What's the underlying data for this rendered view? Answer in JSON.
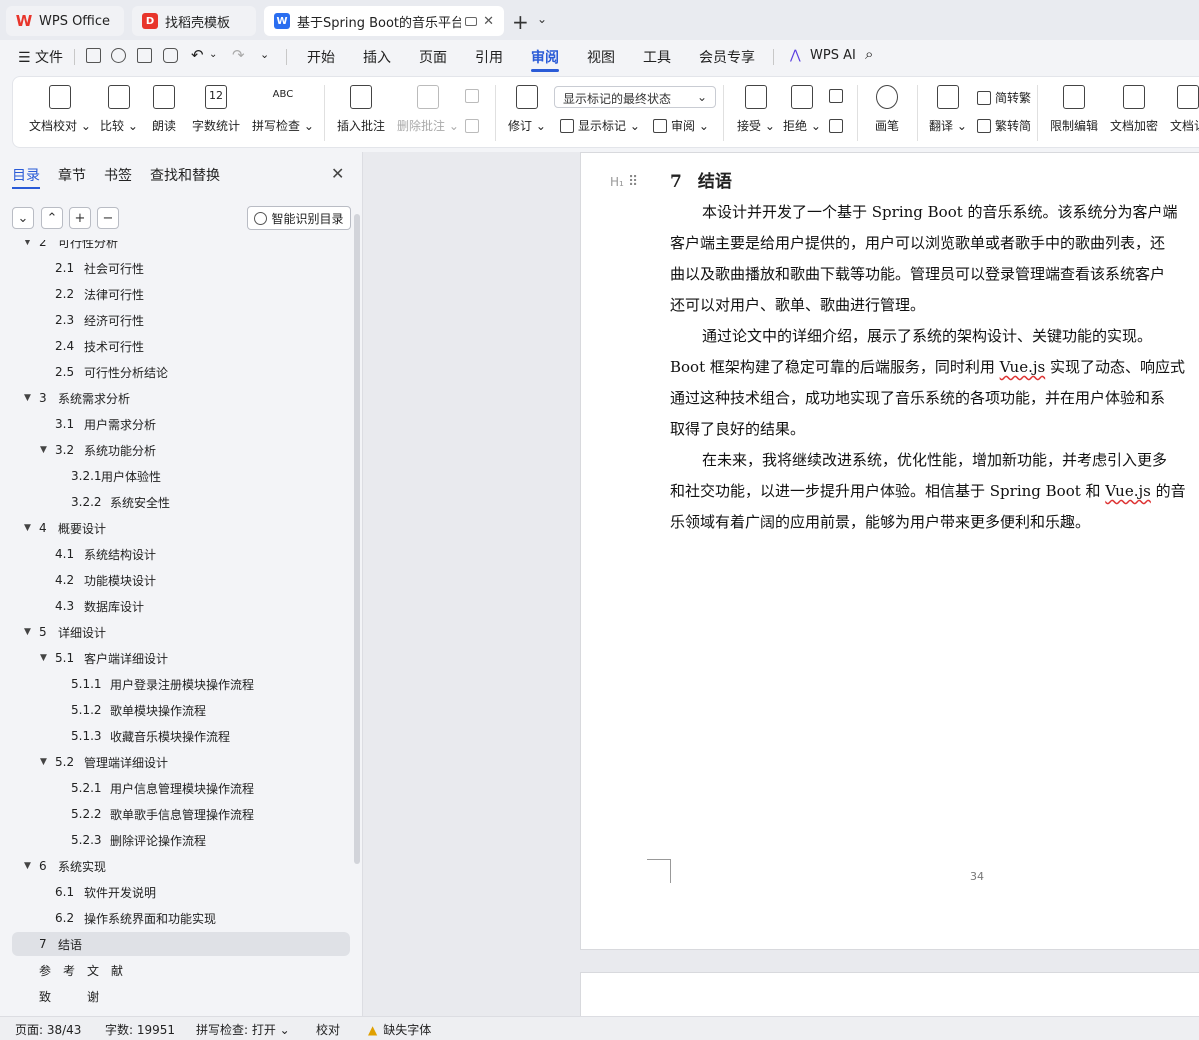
{
  "tabs": [
    {
      "label": "WPS Office",
      "icon": "wps-logo-icon"
    },
    {
      "label": "找稻壳模板",
      "icon": "docer-icon"
    },
    {
      "label": "基于Spring Boot的音乐平台设",
      "icon": "word-doc-icon"
    }
  ],
  "menu": {
    "file": "文件",
    "items": [
      "开始",
      "插入",
      "页面",
      "引用",
      "审阅",
      "视图",
      "工具",
      "会员专享"
    ],
    "active": "审阅",
    "wps_ai": "WPS AI"
  },
  "ribbon": {
    "doc_check": "文档校对",
    "compare": "比较",
    "read_aloud": "朗读",
    "word_count": "字数统计",
    "word_count_icon_text": "12",
    "spell_check": "拼写检查",
    "spell_icon_text": "ABC",
    "insert_comment": "插入批注",
    "delete_comment": "删除批注",
    "track_changes": "修订",
    "markup_mode": "显示标记的最终状态",
    "show_markup": "显示标记",
    "review": "审阅",
    "accept": "接受",
    "reject": "拒绝",
    "pen": "画笔",
    "translate": "翻译",
    "to_traditional": "简转繁",
    "to_simplified": "繁转简",
    "restrict_edit": "限制编辑",
    "encrypt": "文档加密",
    "doc_more": "文档认"
  },
  "nav": {
    "tabs": [
      "目录",
      "章节",
      "书签",
      "查找和替换"
    ],
    "smart_toc": "智能识别目录",
    "toc": [
      {
        "num": "2",
        "text": "可行性分析",
        "level": 1,
        "expanded": true
      },
      {
        "num": "2.1",
        "text": "社会可行性",
        "level": 2
      },
      {
        "num": "2.2",
        "text": "法律可行性",
        "level": 2
      },
      {
        "num": "2.3",
        "text": "经济可行性",
        "level": 2
      },
      {
        "num": "2.4",
        "text": "技术可行性",
        "level": 2
      },
      {
        "num": "2.5",
        "text": "可行性分析结论",
        "level": 2
      },
      {
        "num": "3",
        "text": "系统需求分析",
        "level": 1,
        "expanded": true
      },
      {
        "num": "3.1",
        "text": "用户需求分析",
        "level": 2
      },
      {
        "num": "3.2",
        "text": "系统功能分析",
        "level": 2,
        "expanded": true
      },
      {
        "num": "3.2.1",
        "text": "用户体验性",
        "level": 3
      },
      {
        "num": "3.2.2",
        "text": "系统安全性",
        "level": 3
      },
      {
        "num": "4",
        "text": "概要设计",
        "level": 1,
        "expanded": true
      },
      {
        "num": "4.1",
        "text": "系统结构设计",
        "level": 2
      },
      {
        "num": "4.2",
        "text": "功能模块设计",
        "level": 2
      },
      {
        "num": "4.3",
        "text": "数据库设计",
        "level": 2
      },
      {
        "num": "5",
        "text": "详细设计",
        "level": 1,
        "expanded": true
      },
      {
        "num": "5.1",
        "text": "客户端详细设计",
        "level": 2,
        "expanded": true
      },
      {
        "num": "5.1.1",
        "text": "用户登录注册模块操作流程",
        "level": 3
      },
      {
        "num": "5.1.2",
        "text": "歌单模块操作流程",
        "level": 3
      },
      {
        "num": "5.1.3",
        "text": "收藏音乐模块操作流程",
        "level": 3
      },
      {
        "num": "5.2",
        "text": "管理端详细设计",
        "level": 2,
        "expanded": true
      },
      {
        "num": "5.2.1",
        "text": "用户信息管理模块操作流程",
        "level": 3
      },
      {
        "num": "5.2.2",
        "text": "歌单歌手信息管理操作流程",
        "level": 3
      },
      {
        "num": "5.2.3",
        "text": "删除评论操作流程",
        "level": 3
      },
      {
        "num": "6",
        "text": "系统实现",
        "level": 1,
        "expanded": true
      },
      {
        "num": "6.1",
        "text": "软件开发说明",
        "level": 2
      },
      {
        "num": "6.2",
        "text": "操作系统界面和功能实现",
        "level": 2
      },
      {
        "num": "7",
        "text": "结语",
        "level": 1,
        "selected": true
      },
      {
        "num": "",
        "text": "参　考　文　献",
        "level": 1
      },
      {
        "num": "",
        "text": "致　　　谢",
        "level": 1
      }
    ]
  },
  "document": {
    "heading_num": "7",
    "heading_text": "结语",
    "lines": [
      {
        "indent": true,
        "parts": [
          {
            "t": "本设计并开发了一个基于 Spring Boot 的音乐系统。该系统分为客户端"
          }
        ]
      },
      {
        "indent": false,
        "parts": [
          {
            "t": "客户端主要是给用户提供的，用户可以浏览歌单或者歌手中的歌曲列表，还"
          }
        ]
      },
      {
        "indent": false,
        "parts": [
          {
            "t": "曲以及歌曲播放和歌曲下载等功能。管理员可以登录管理端查看该系统客户"
          }
        ]
      },
      {
        "indent": false,
        "parts": [
          {
            "t": "还可以对用户、歌单、歌曲进行管理。"
          }
        ]
      },
      {
        "indent": true,
        "parts": [
          {
            "t": "通过论文中的详细介绍，展示了系统的架构设计、关键功能的实现。"
          }
        ]
      },
      {
        "indent": false,
        "parts": [
          {
            "t": "Boot 框架构建了稳定可靠的后端服务，同时利用 "
          },
          {
            "t": "Vue.js",
            "wavy": true
          },
          {
            "t": " 实现了动态、响应式"
          }
        ]
      },
      {
        "indent": false,
        "parts": [
          {
            "t": "通过这种技术组合，成功地实现了音乐系统的各项功能，并在用户体验和系"
          }
        ]
      },
      {
        "indent": false,
        "parts": [
          {
            "t": "取得了良好的结果。"
          }
        ]
      },
      {
        "indent": true,
        "parts": [
          {
            "t": "在未来，我将继续改进系统，优化性能，增加新功能，并考虑引入更多"
          }
        ]
      },
      {
        "indent": false,
        "parts": [
          {
            "t": "和社交功能，以进一步提升用户体验。相信基于 Spring Boot 和 "
          },
          {
            "t": "Vue.js",
            "wavy": true
          },
          {
            "t": " 的音"
          }
        ]
      },
      {
        "indent": false,
        "parts": [
          {
            "t": "乐领域有着广阔的应用前景，能够为用户带来更多便利和乐趣。"
          }
        ]
      }
    ],
    "page_number": "34"
  },
  "status": {
    "page": "页面: 38/43",
    "word_count": "字数: 19951",
    "spell_check": "拼写检查: 打开",
    "proofread": "校对",
    "missing_font": "缺失字体"
  }
}
